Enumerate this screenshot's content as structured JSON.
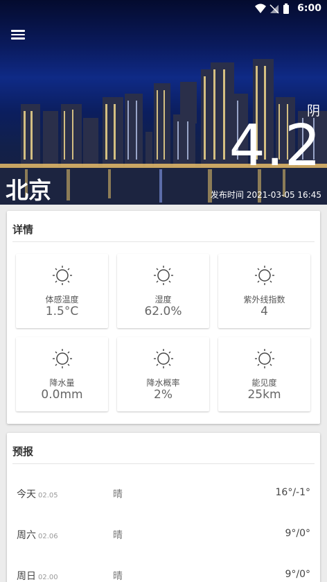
{
  "status_bar": {
    "time": "6:00",
    "icons": [
      "wifi-icon",
      "signal-icon",
      "battery-icon"
    ]
  },
  "header": {
    "menu_icon": "menu-icon",
    "condition": "阴",
    "temperature": "4.2",
    "city": "北京",
    "published_label": "发布时间",
    "published_time": "2021-03-05 16:45"
  },
  "details": {
    "title": "详情",
    "icon": "sun-icon",
    "items": [
      {
        "label": "体感温度",
        "value": "1.5°C"
      },
      {
        "label": "湿度",
        "value": "62.0%"
      },
      {
        "label": "紫外线指数",
        "value": "4"
      },
      {
        "label": "降水量",
        "value": "0.0mm"
      },
      {
        "label": "降水概率",
        "value": "2%"
      },
      {
        "label": "能见度",
        "value": "25km"
      }
    ]
  },
  "forecast": {
    "title": "预报",
    "rows": [
      {
        "day": "今天",
        "date": "02.05",
        "condition": "晴",
        "temps": "16°/-1°"
      },
      {
        "day": "周六",
        "date": "02.06",
        "condition": "晴",
        "temps": "9°/0°"
      },
      {
        "day": "周日",
        "date": "02.00",
        "condition": "晴",
        "temps": "9°/0°"
      }
    ]
  },
  "colors": {
    "card_bg": "#ffffff",
    "page_bg": "#ececec",
    "hero_sky": "#0f2a86",
    "text_on_hero": "#ffffff"
  }
}
